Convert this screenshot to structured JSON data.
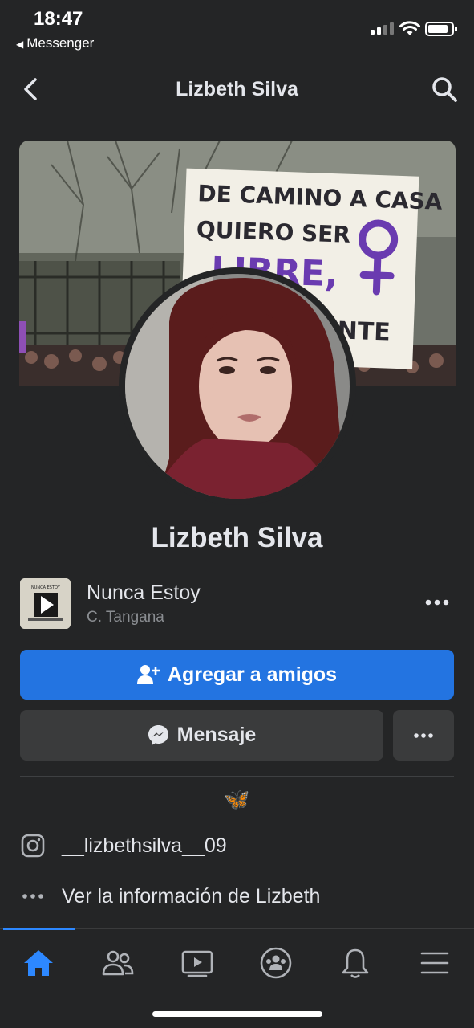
{
  "status_bar": {
    "time": "18:47",
    "back_app": "Messenger"
  },
  "nav": {
    "title": "Lizbeth Silva"
  },
  "cover": {
    "sign_lines": [
      "DE CAMINO A CASA",
      "QUIERO SER",
      "LIBRE,",
      "NTE"
    ]
  },
  "profile": {
    "name": "Lizbeth Silva"
  },
  "song": {
    "cover_label": "NUNCA ESTOY",
    "title": "Nunca Estoy",
    "artist": "C. Tangana"
  },
  "actions": {
    "add_friend": "Agregar a amigos",
    "message": "Mensaje"
  },
  "bio": {
    "emoji": "🦋"
  },
  "info": {
    "instagram": "__lizbethsilva__09",
    "see_info": "Ver la información de Lizbeth"
  },
  "tabs": [
    "home",
    "friends",
    "watch",
    "groups",
    "notifications",
    "menu"
  ],
  "colors": {
    "background": "#242526",
    "accent": "#2374e1",
    "button_secondary": "#3a3b3c",
    "text": "#e4e6eb",
    "muted": "#8a8d91"
  }
}
